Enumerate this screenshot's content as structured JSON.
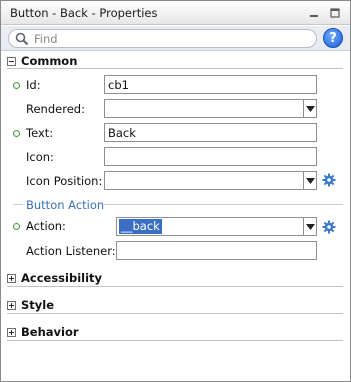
{
  "window": {
    "title": "Button - Back - Properties",
    "minimize_label": "_",
    "restore_label": "▢"
  },
  "search": {
    "placeholder": "Find",
    "help_label": "?"
  },
  "sections": {
    "common": {
      "title": "Common",
      "expanded": true
    },
    "accessibility": {
      "title": "Accessibility",
      "expanded": false
    },
    "style": {
      "title": "Style",
      "expanded": false
    },
    "behavior": {
      "title": "Behavior",
      "expanded": false
    }
  },
  "common": {
    "id": {
      "label": "Id:",
      "value": "cb1"
    },
    "rendered": {
      "label": "Rendered:",
      "value": ""
    },
    "text": {
      "label": "Text:",
      "value": "Back"
    },
    "icon": {
      "label": "Icon:",
      "value": ""
    },
    "icon_position": {
      "label": "Icon Position:",
      "value": ""
    }
  },
  "button_action": {
    "heading": "Button Action",
    "action": {
      "label": "Action:",
      "value": "__back"
    },
    "action_listener": {
      "label": "Action Listener:",
      "value": ""
    }
  },
  "colors": {
    "required_marker": "#3f9a3f",
    "heading_blue": "#3a6fb5",
    "selection": "#3a6fc4",
    "help_button": "#1f5fd6"
  },
  "icons": {
    "help": "question-circle",
    "search": "magnifier",
    "gear": "gear",
    "required": "green-ring"
  }
}
